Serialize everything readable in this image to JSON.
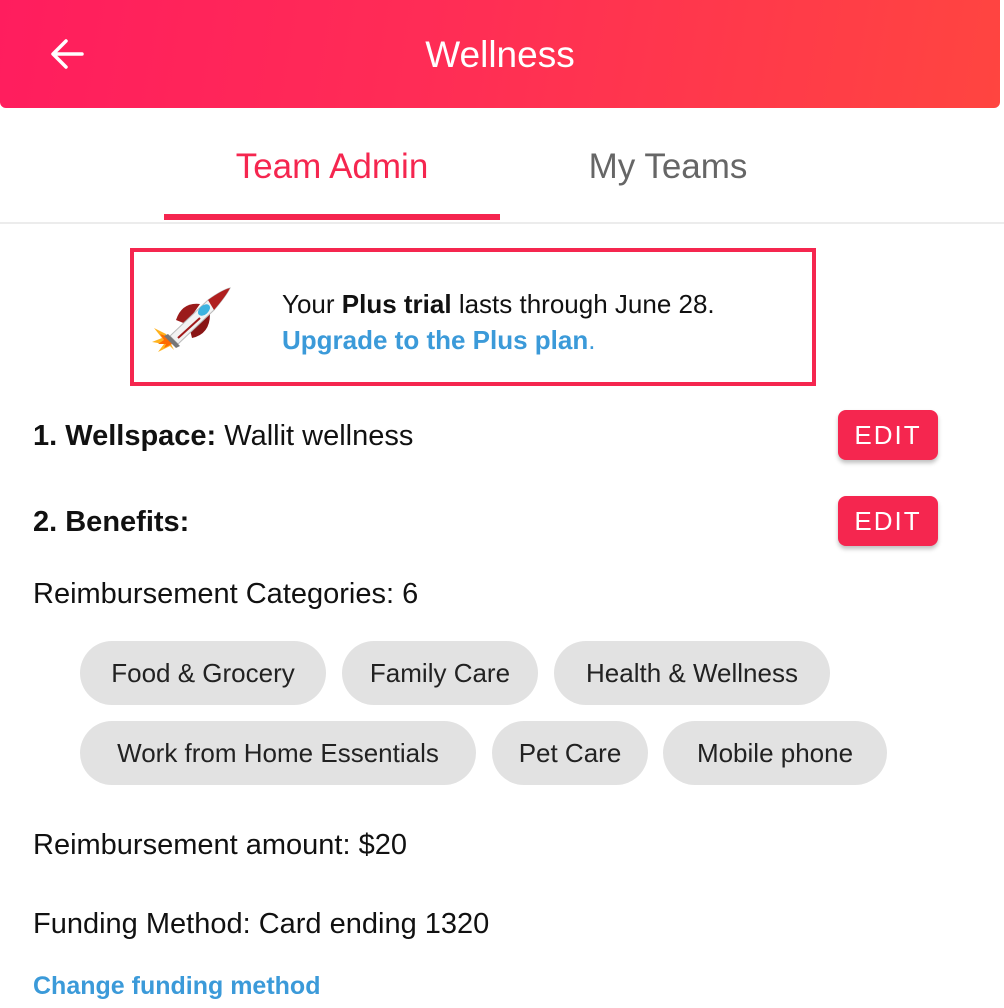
{
  "appbar": {
    "title": "Wellness",
    "back_icon": "arrow-left-icon",
    "gradient_colors": [
      "#ff1d5e",
      "#ff4540"
    ]
  },
  "tabs": [
    {
      "label": "Team Admin",
      "active": true
    },
    {
      "label": "My Teams",
      "active": false
    }
  ],
  "promo": {
    "icon": "rocket-icon",
    "text_prefix": "Your ",
    "text_bold": "Plus trial",
    "text_suffix": " lasts through June 28.",
    "link_label": "Upgrade to the Plus plan",
    "link_suffix": ".",
    "border_color": "#f5264f"
  },
  "sections": {
    "wellspace": {
      "label": "1. Wellspace:",
      "value": " Wallit wellness",
      "edit_label": "EDIT"
    },
    "benefits": {
      "label": "2. Benefits:",
      "edit_label": "EDIT"
    }
  },
  "reimbursement": {
    "categories_label": "Reimbursement Categories: 6",
    "categories": [
      "Food & Grocery",
      "Family Care",
      "Health & Wellness",
      "Work from Home Essentials",
      "Pet Care",
      "Mobile phone"
    ],
    "amount_label": "Reimbursement amount: $20"
  },
  "funding": {
    "label": "Funding Method: Card ending 1320",
    "change_link": "Change funding method"
  },
  "colors": {
    "accent": "#f5264f",
    "link": "#3b9ad9",
    "chip_bg": "#e2e2e2"
  }
}
